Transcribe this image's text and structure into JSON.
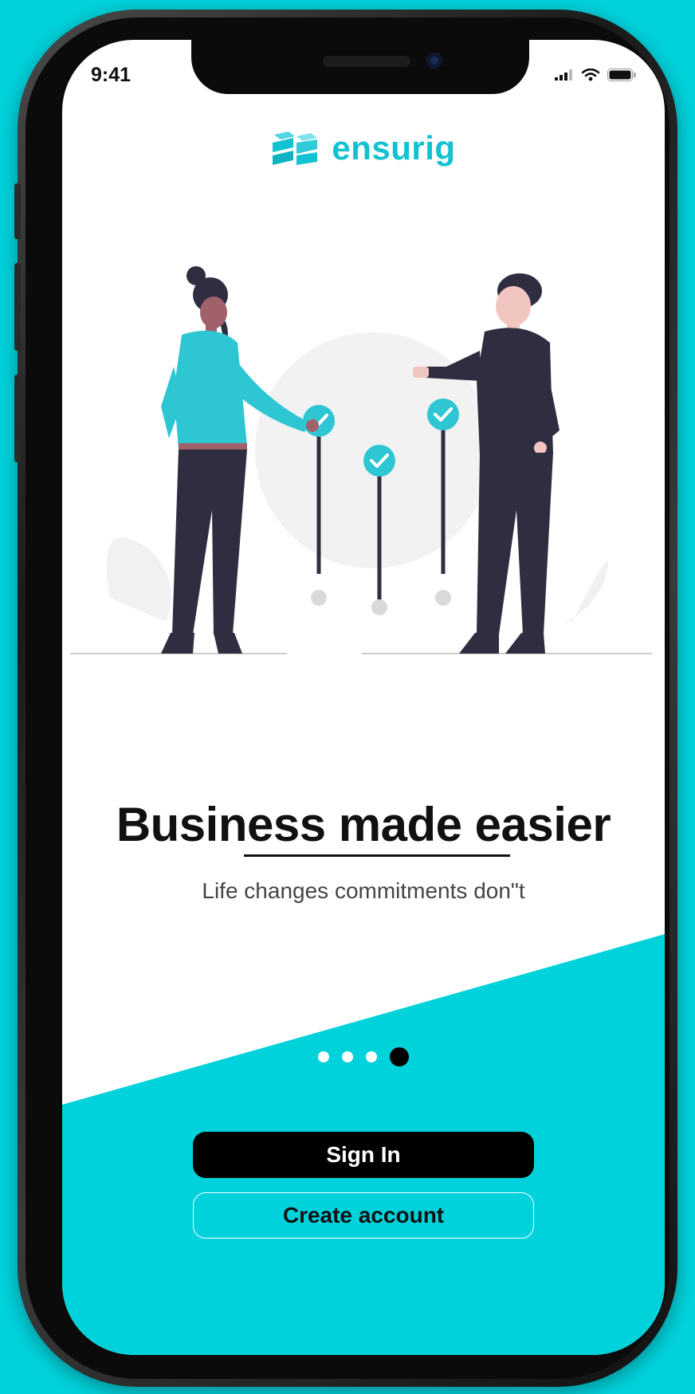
{
  "status_bar": {
    "time": "9:41"
  },
  "brand": {
    "name": "ensurig",
    "accent": "#12c2d0"
  },
  "hero": {
    "headline": "Business made easier",
    "subtitle": "Life changes commitments don\"t"
  },
  "pagination": {
    "total": 4,
    "active_index": 3
  },
  "actions": {
    "sign_in_label": "Sign In",
    "create_account_label": "Create account"
  },
  "colors": {
    "background": "#00d2dc",
    "primary_button": "#000000",
    "illustration_accent": "#2fc6d4",
    "illustration_dark": "#2f2e41"
  }
}
